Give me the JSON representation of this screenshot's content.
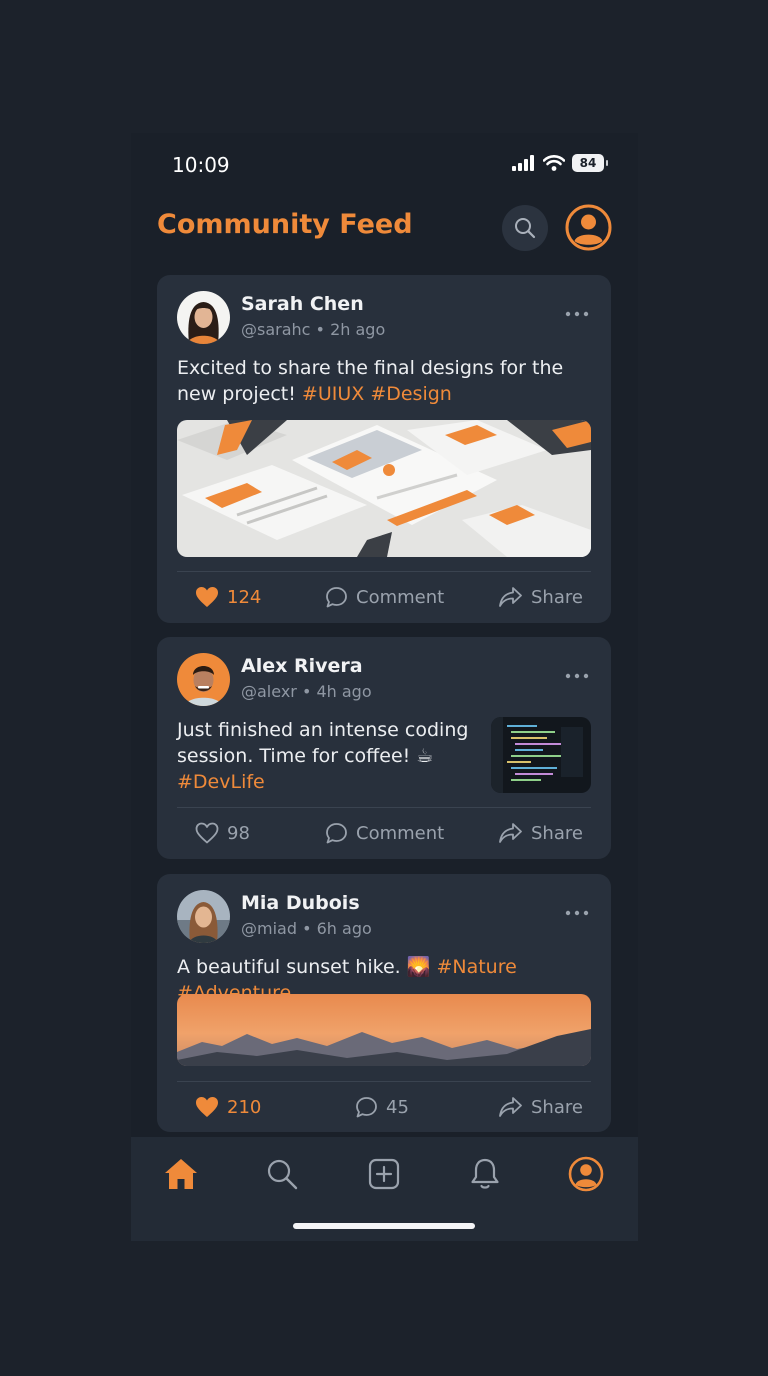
{
  "status_bar": {
    "time": "10:09",
    "battery": "84"
  },
  "header": {
    "title": "Community Feed"
  },
  "colors": {
    "accent": "#ef8a3a",
    "background": "#1a2029",
    "card": "#28303c",
    "muted": "#9aa2ad"
  },
  "posts": [
    {
      "name": "Sarah Chen",
      "meta": "@sarahc • 2h ago",
      "text": "Excited to share the final designs for the new project! ",
      "hashtags": "#UIUX #Design",
      "likes": "124",
      "liked": true,
      "comment_label": "Comment",
      "share_label": "Share",
      "image": "design-mockups-image"
    },
    {
      "name": "Alex Rivera",
      "meta": "@alexr • 4h ago",
      "text": "Just finished an intense coding session. Time for coffee! ☕",
      "hashtags": "#DevLife",
      "likes": "98",
      "liked": false,
      "comment_label": "Comment",
      "share_label": "Share",
      "image": "code-editor-thumbnail"
    },
    {
      "name": "Mia Dubois",
      "meta": "@miad • 6h ago",
      "text": "A beautiful sunset hike. 🌄 ",
      "hashtags": "#Nature #Adventure",
      "likes": "210",
      "liked": true,
      "comments": "45",
      "share_label": "Share",
      "image": "sunset-mountains-image"
    }
  ],
  "nav": {
    "items": [
      "home-icon",
      "search-icon",
      "add-post-icon",
      "notifications-icon",
      "profile-icon"
    ],
    "active": "home-icon"
  }
}
